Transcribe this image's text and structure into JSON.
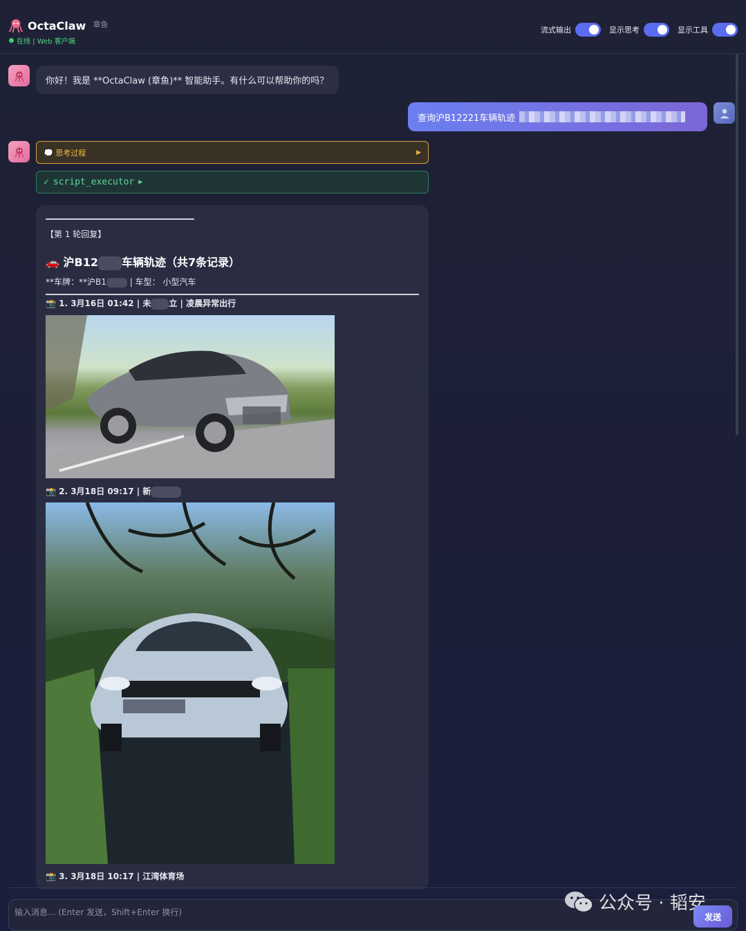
{
  "header": {
    "app_name": "OctaClaw",
    "app_sub": "章鱼",
    "status": "在线 | Web 客户端",
    "toggles": [
      {
        "label": "流式输出",
        "on": true
      },
      {
        "label": "显示思考",
        "on": true
      },
      {
        "label": "显示工具",
        "on": true
      }
    ]
  },
  "messages": {
    "greeting": "你好！我是 **OctaClaw (章鱼)** 智能助手。有什么可以帮助你的吗？",
    "user_query": "查询沪B12221车辆轨迹",
    "thinking_label": "💭 思考过程",
    "tool_name": "script_executor"
  },
  "card": {
    "round": "【第 1 轮回复】",
    "title_a": "🚗 沪B12",
    "title_b": "车辆轨迹（共7条记录）",
    "meta_a": "**车牌：**沪B1",
    "meta_b": "| 车型： 小型汽车",
    "rec1_a": "📸 1. 3月16日 01:42 | 未",
    "rec1_b": "立 | 凌晨异常出行",
    "rec2": "📸 2. 3月18日 09:17 | 新",
    "rec3": "📸 3. 3月18日 10:17 | 江湾体育场"
  },
  "input": {
    "placeholder": "输入消息... (Enter 发送，Shift+Enter 换行)",
    "send_label": "发送"
  },
  "watermark": "公众号 · 韬安",
  "colors": {
    "accent": "#5b6cf0",
    "online": "#3ecf6d",
    "think": "#f0b84b",
    "tool": "#5fd89a"
  }
}
